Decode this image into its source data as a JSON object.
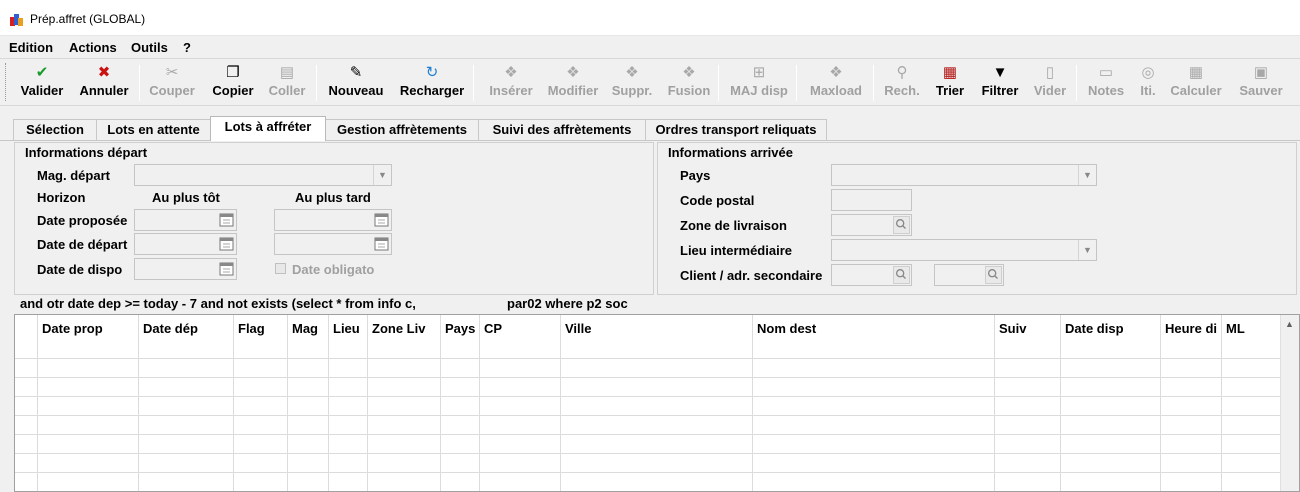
{
  "window": {
    "title": "Prép.affret (GLOBAL)"
  },
  "menu": [
    "Edition",
    "Actions",
    "Outils",
    "?"
  ],
  "toolbar": [
    {
      "label": "Valider",
      "icon": "check-icon",
      "glyph": "✔",
      "enabled": true,
      "color": "#1a9a2a"
    },
    {
      "label": "Annuler",
      "icon": "x-icon",
      "glyph": "✖",
      "enabled": true,
      "color": "#cc1111"
    },
    {
      "label": "Couper",
      "icon": "scissors-icon",
      "glyph": "✂",
      "enabled": false
    },
    {
      "label": "Copier",
      "icon": "copy-icon",
      "glyph": "❐",
      "enabled": true
    },
    {
      "label": "Coller",
      "icon": "paste-icon",
      "glyph": "▤",
      "enabled": false
    },
    {
      "label": "Nouveau",
      "icon": "new-icon",
      "glyph": "✎",
      "enabled": true
    },
    {
      "label": "Recharger",
      "icon": "reload-icon",
      "glyph": "↻",
      "enabled": true,
      "color": "#1e7fd1"
    },
    {
      "label": "Insérer",
      "icon": "insert-icon",
      "glyph": "❖",
      "enabled": false
    },
    {
      "label": "Modifier",
      "icon": "modify-icon",
      "glyph": "❖",
      "enabled": false
    },
    {
      "label": "Suppr.",
      "icon": "delete-icon",
      "glyph": "❖",
      "enabled": false
    },
    {
      "label": "Fusion",
      "icon": "merge-icon",
      "glyph": "❖",
      "enabled": false
    },
    {
      "label": "MAJ disp",
      "icon": "update-disp-icon",
      "glyph": "⊞",
      "enabled": false
    },
    {
      "label": "Maxload",
      "icon": "maxload-icon",
      "glyph": "❖",
      "enabled": false
    },
    {
      "label": "Rech.",
      "icon": "search-icon",
      "glyph": "⚲",
      "enabled": false
    },
    {
      "label": "Trier",
      "icon": "sort-icon",
      "glyph": "▦",
      "enabled": true,
      "color": "#b01010"
    },
    {
      "label": "Filtrer",
      "icon": "filter-icon",
      "glyph": "▼",
      "enabled": true
    },
    {
      "label": "Vider",
      "icon": "clear-icon",
      "glyph": "▯",
      "enabled": false
    },
    {
      "label": "Notes",
      "icon": "notes-icon",
      "glyph": "▭",
      "enabled": false
    },
    {
      "label": "Iti.",
      "icon": "itinerary-icon",
      "glyph": "◎",
      "enabled": false
    },
    {
      "label": "Calculer",
      "icon": "calculator-icon",
      "glyph": "▦",
      "enabled": false
    },
    {
      "label": "Sauver",
      "icon": "save-icon",
      "glyph": "▣",
      "enabled": false
    }
  ],
  "tabs": [
    {
      "label": "Sélection",
      "active": false
    },
    {
      "label": "Lots en attente",
      "active": false
    },
    {
      "label": "Lots à affréter",
      "active": true
    },
    {
      "label": "Gestion affrètements",
      "active": false
    },
    {
      "label": "Suivi des affrètements",
      "active": false
    },
    {
      "label": "Ordres transport reliquats",
      "active": false
    }
  ],
  "depart": {
    "title": "Informations départ",
    "mag_label": "Mag. départ",
    "horizon_label": "Horizon",
    "au_plus_tot": "Au plus tôt",
    "au_plus_tard": "Au plus tard",
    "date_proposee": "Date proposée",
    "date_depart": "Date de départ",
    "date_dispo": "Date de dispo",
    "date_obligatoire": "Date obligato"
  },
  "arrivee": {
    "title": "Informations arrivée",
    "pays": "Pays",
    "code_postal": "Code postal",
    "zone_livraison": "Zone de livraison",
    "lieu_intermediaire": "Lieu intermédiaire",
    "client_adr": "Client / adr. secondaire"
  },
  "sql": {
    "part1": "and otr  date  dep >= today - 7 and not exists (select * from info  c,",
    "part2": "par02 where p2  soc"
  },
  "grid": {
    "columns": [
      "Date prop",
      "Date dép",
      "Flag",
      "Mag",
      "Lieu",
      "Zone Liv",
      "Pays",
      "CP",
      "Ville",
      "Nom dest",
      "Suiv",
      "Date disp",
      "Heure di",
      "ML"
    ],
    "empty_rows": 7
  }
}
